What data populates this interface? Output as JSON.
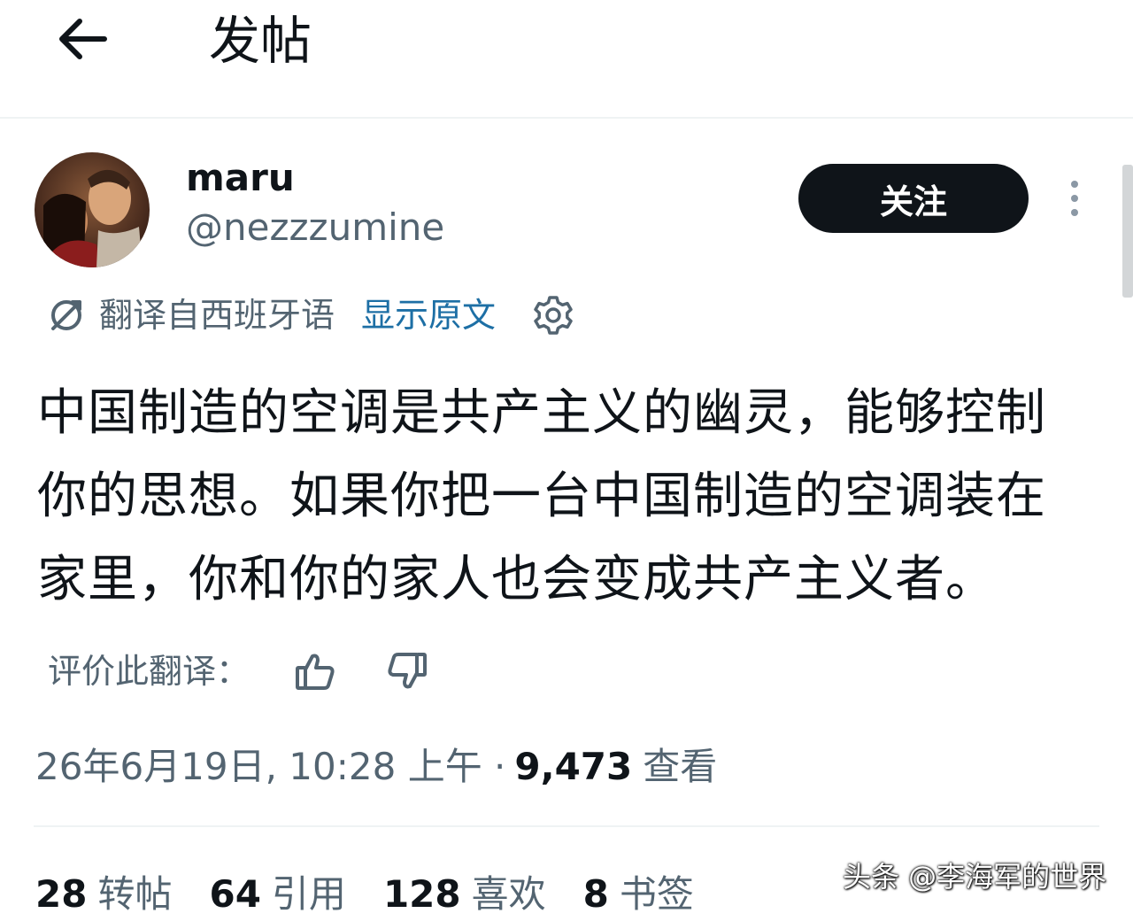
{
  "header": {
    "title": "发帖"
  },
  "author": {
    "name": "maru",
    "handle": "@nezzzumine"
  },
  "follow_label": "关注",
  "translation": {
    "label": "翻译自西班牙语",
    "show_original": "显示原文"
  },
  "tweet": {
    "text": "中国制造的空调是共产主义的幽灵，能够控制你的思想。如果你把一台中国制造的空调装在家里，你和你的家人也会变成共产主义者。"
  },
  "rate": {
    "label": "评价此翻译："
  },
  "meta": {
    "timestamp": "26年6月19日, 10:28 上午 ·",
    "views": "9,473",
    "views_label": "查看"
  },
  "stats": [
    {
      "num": "28",
      "label": "转帖"
    },
    {
      "num": "64",
      "label": "引用"
    },
    {
      "num": "128",
      "label": "喜欢"
    },
    {
      "num": "8",
      "label": "书签"
    }
  ],
  "watermark": "头条 @李海军的世界",
  "icons": {
    "back": "arrow-left-icon",
    "more": "more-vertical-icon",
    "translate": "translate-icon",
    "settings": "gear-icon",
    "like": "thumbs-up-icon",
    "dislike": "thumbs-down-icon"
  },
  "colors": {
    "text": "#0f1419",
    "secondary": "#536471",
    "link": "#1d6fa5",
    "button": "#0f1419"
  }
}
